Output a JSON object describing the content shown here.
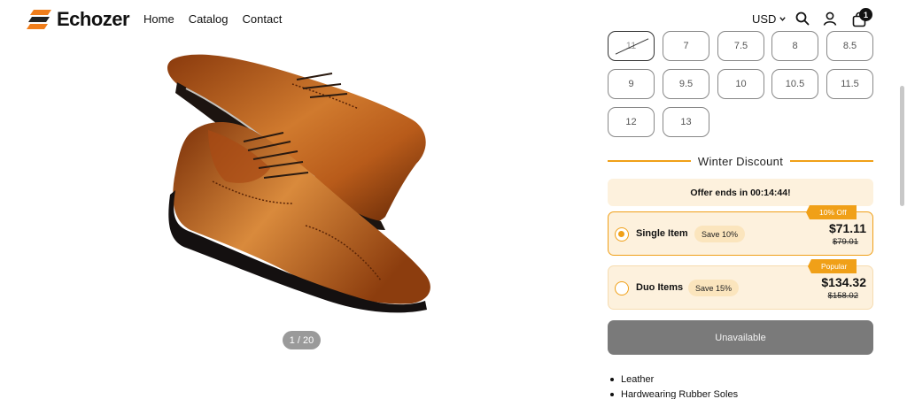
{
  "brand": {
    "name": "Echozer",
    "accent": "#f07d1a"
  },
  "nav": [
    "Home",
    "Catalog",
    "Contact"
  ],
  "header": {
    "currency": "USD",
    "cart_count": "1",
    "icons": [
      "search-icon",
      "user-icon",
      "cart-icon"
    ]
  },
  "gallery": {
    "pager": "1 / 20"
  },
  "sizes": {
    "row1": [
      "11",
      "7",
      "7.5",
      "8",
      "8.5"
    ],
    "row2": [
      "9",
      "9.5",
      "10",
      "10.5",
      "11.5"
    ],
    "row3": [
      "12",
      "13"
    ],
    "crossed_out": "11"
  },
  "discount": {
    "title": "Winter Discount",
    "offer_text": "Offer ends in 00:14:44!",
    "accent": "#f0a018",
    "options": [
      {
        "label": "Single Item",
        "save": "Save 10%",
        "price": "$71.11",
        "old_price": "$79.01",
        "ribbon": "10% Off",
        "selected": true
      },
      {
        "label": "Duo Items",
        "save": "Save 15%",
        "price": "$134.32",
        "old_price": "$158.02",
        "ribbon": "Popular",
        "selected": false
      }
    ]
  },
  "cta": {
    "label": "Unavailable",
    "color": "#7a7a7a"
  },
  "features": [
    "Leather",
    "Hardwearing Rubber Soles"
  ]
}
